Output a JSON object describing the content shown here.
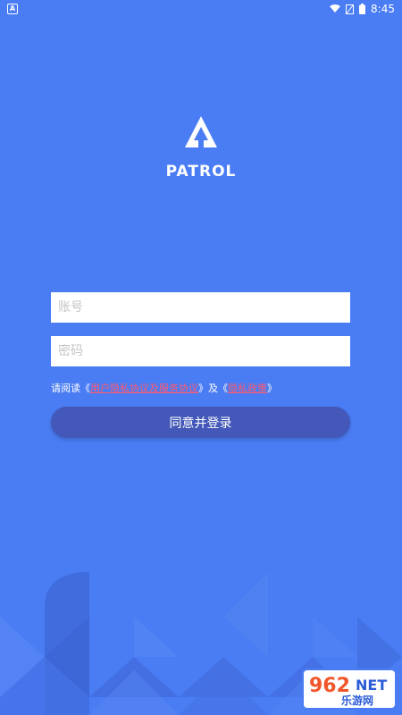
{
  "status_bar": {
    "time": "8:45",
    "icons": [
      "app-notification-icon",
      "wifi-icon",
      "no-signal-icon",
      "battery-icon"
    ]
  },
  "app": {
    "logo_icon": "tree-triangle-logo-icon",
    "title": "PATROL"
  },
  "form": {
    "account_placeholder": "账号",
    "password_placeholder": "密码",
    "account_value": "",
    "password_value": ""
  },
  "agreement": {
    "prefix": "请阅读《",
    "link1": "用户隐私协议及服务协议",
    "middle": "》及《",
    "link2": "隐私政策",
    "suffix": "》"
  },
  "login_button": "同意并登录",
  "watermark": {
    "number": "962",
    "suffix": "NET",
    "subtitle": "乐游网"
  },
  "colors": {
    "background": "#4a7cf3",
    "button": "#4358b8",
    "link": "#ff5a6e"
  }
}
